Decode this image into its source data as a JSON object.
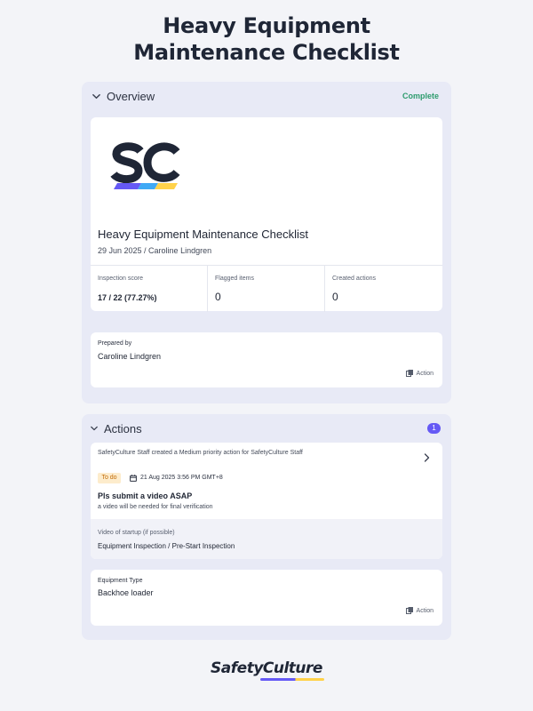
{
  "page": {
    "title_line1": "Heavy Equipment",
    "title_line2": "Maintenance Checklist"
  },
  "overview": {
    "heading": "Overview",
    "status": "Complete",
    "logo_icon": "safetyculture-sc-logo",
    "report_title": "Heavy Equipment Maintenance Checklist",
    "report_subtitle": "29 Jun 2025 / Caroline Lindgren",
    "stats": [
      {
        "label": "Inspection score",
        "value": "17 / 22 (77.27%)"
      },
      {
        "label": "Flagged items",
        "value": "0"
      },
      {
        "label": "Created actions",
        "value": "0"
      }
    ],
    "prepared_by": {
      "label": "Prepared by",
      "value": "Caroline Lindgren",
      "action_label": "Action"
    }
  },
  "actions": {
    "heading": "Actions",
    "count": "1",
    "item": {
      "meta": "SafetyCulture Staff created a Medium priority action for SafetyCulture Staff",
      "status": "To do",
      "due": "21 Aug 2025 3:56 PM GMT+8",
      "title": "Pls submit a video ASAP",
      "description": "a video will be needed for final verification",
      "question": "Video of startup (if possible)",
      "source": "Equipment Inspection / Pre-Start Inspection"
    },
    "equipment": {
      "label": "Equipment Type",
      "value": "Backhoe loader",
      "action_label": "Action"
    }
  },
  "brand": {
    "name": "SafetyCulture"
  },
  "colors": {
    "accent": "#6559f5",
    "complete": "#2e9c6e",
    "todo_bg": "#fdeccc",
    "todo_text": "#c26a05",
    "logo_yellow": "#ffd24a",
    "logo_blue": "#3fa9f5"
  }
}
